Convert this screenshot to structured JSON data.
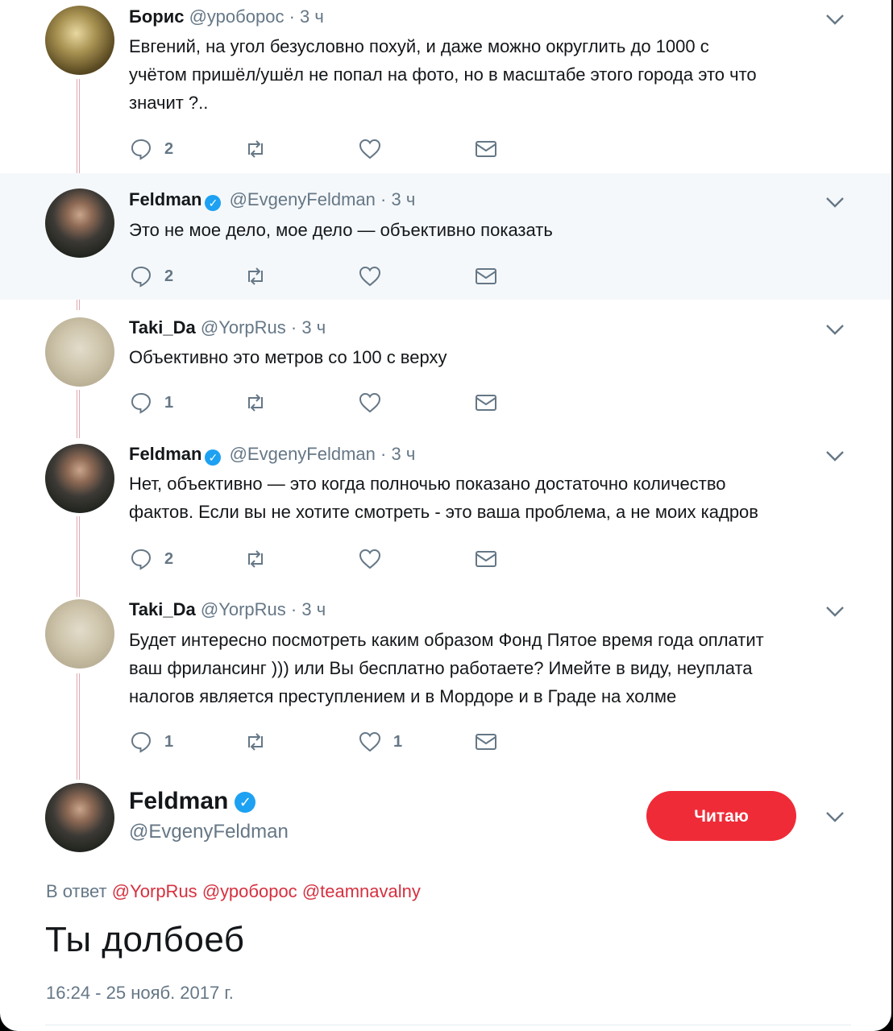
{
  "tweets": [
    {
      "name": "Борис",
      "handle": "@уроборос",
      "time": "3 ч",
      "text_lines": [
        "Евгений, на угол безусловно похуй, и даже можно округлить до 1000 с",
        "учётом пришёл/ушёл не попал на фото, но в масштабе этого города это что",
        "значит ?.."
      ],
      "reply_count": "2",
      "retweet_count": "",
      "like_count": "",
      "verified": false,
      "avatar": "boris-avatar"
    },
    {
      "name": "Feldman",
      "handle": "@EvgenyFeldman",
      "time": "3 ч",
      "text_lines": [
        "Это не мое дело, мое дело — объективно показать"
      ],
      "reply_count": "2",
      "retweet_count": "",
      "like_count": "",
      "verified": true,
      "avatar": "feldman-avatar"
    },
    {
      "name": "Taki_Da",
      "handle": "@YorpRus",
      "time": "3 ч",
      "text_lines": [
        "Объективно это метров со 100 с верху"
      ],
      "reply_count": "1",
      "retweet_count": "",
      "like_count": "",
      "verified": false,
      "avatar": "taki-avatar"
    },
    {
      "name": "Feldman",
      "handle": "@EvgenyFeldman",
      "time": "3 ч",
      "text_lines": [
        "Нет, объективно — это когда полночью показано достаточно количество",
        "фактов. Если вы не хотите смотреть - это ваша проблема, а не моих кадров"
      ],
      "reply_count": "2",
      "retweet_count": "",
      "like_count": "",
      "verified": true,
      "avatar": "feldman-avatar"
    },
    {
      "name": "Taki_Da",
      "handle": "@YorpRus",
      "time": "3 ч",
      "text_lines": [
        "Будет интересно посмотреть каким образом Фонд Пятое время года оплатит",
        "ваш фрилансинг ))) или Вы бесплатно работаете? Имейте в виду, неуплата",
        "налогов является преступлением и в Мордоре и в Граде на холме"
      ],
      "reply_count": "1",
      "retweet_count": "",
      "like_count": "1",
      "verified": false,
      "avatar": "taki-avatar"
    }
  ],
  "main_tweet": {
    "name": "Feldman",
    "handle": "@EvgenyFeldman",
    "follow_label": "Читаю",
    "reply_prefix": "В ответ",
    "reply_mentions": [
      "@YorpRus",
      "@уроборос",
      "@teamnavalny"
    ],
    "text": "Ты долбоеб",
    "timestamp": "16:24 - 25 нояб. 2017 г."
  },
  "colors": {
    "accent_blue": "#1da1f2",
    "follow_button": "#ef2b38",
    "mention": "#d6303f",
    "thread_line": "#e3a7ae",
    "muted": "#657786"
  }
}
